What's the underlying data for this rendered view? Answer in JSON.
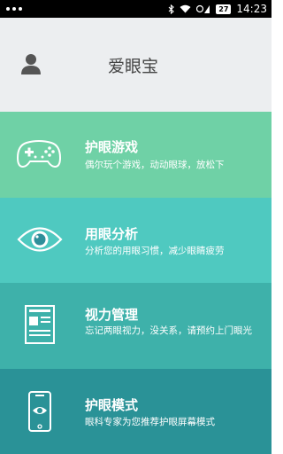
{
  "status_bar": {
    "time": "14:23",
    "battery": "27"
  },
  "header": {
    "app_title": "爱眼宝"
  },
  "menu": [
    {
      "title": "护眼游戏",
      "description": "偶尔玩个游戏，动动眼球，放松下",
      "color": "#6fd1a6",
      "icon": "gamepad-icon"
    },
    {
      "title": "用眼分析",
      "description": "分析您的用眼习惯，减少眼睛疲劳",
      "color": "#4fc9c0",
      "icon": "eye-icon"
    },
    {
      "title": "视力管理",
      "description": "忘记两眼视力，没关系，请预约上门眼光",
      "color": "#3eb1aa",
      "icon": "document-icon"
    },
    {
      "title": "护眼模式",
      "description": "眼科专家为您推荐护眼屏幕模式",
      "color": "#2a9297",
      "icon": "phone-eye-icon"
    }
  ]
}
